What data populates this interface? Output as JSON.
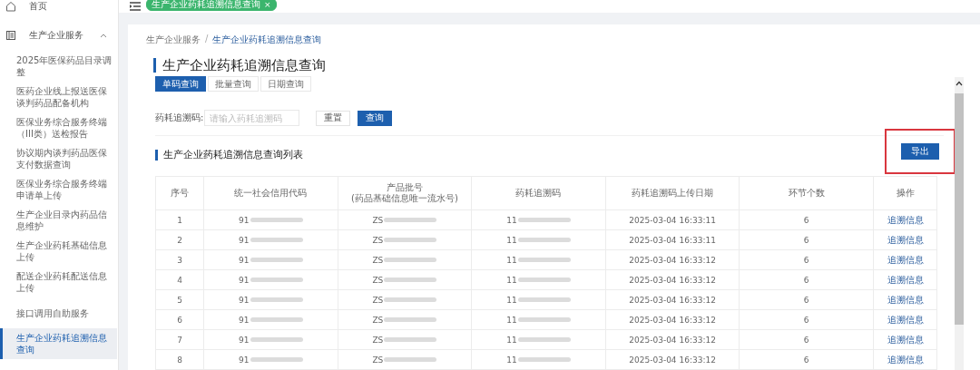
{
  "sidebar": {
    "items": [
      {
        "label": "首页",
        "kind": "home"
      },
      {
        "label": "生产企业服务",
        "kind": "group",
        "expanded": true,
        "children": [
          {
            "label": "2025年医保药品目录调整",
            "selected": false
          },
          {
            "label": "医药企业线上报送医保谈判药品配备机构",
            "selected": false
          },
          {
            "label": "医保业务综合服务终端（III类）送检报告",
            "selected": false
          },
          {
            "label": "协议期内谈判药品医保支付数据查询",
            "selected": false
          },
          {
            "label": "医保业务综合服务终端申请单上传",
            "selected": false
          },
          {
            "label": "生产企业目录内药品信息维护",
            "selected": false
          },
          {
            "label": "生产企业药耗基础信息上传",
            "selected": false
          },
          {
            "label": "配送企业药耗配送信息上传",
            "selected": false
          },
          {
            "label": "接口调用自助服务",
            "selected": false
          },
          {
            "label": "生产企业药耗追溯信息查询",
            "selected": true
          }
        ]
      }
    ]
  },
  "open_tabs": [
    {
      "label": "生产企业药耗追溯信息查询",
      "close": "×",
      "selected": true
    }
  ],
  "breadcrumb": [
    "生产企业服务",
    "生产企业药耗追溯信息查询"
  ],
  "breadcrumb_separator": "/",
  "page_title": "生产企业药耗追溯信息查询",
  "query_tabs": [
    {
      "label": "单码查询",
      "selected": true
    },
    {
      "label": "批量查询",
      "selected": false
    },
    {
      "label": "日期查询",
      "selected": false
    }
  ],
  "filter": {
    "label": "药耗追溯码:",
    "placeholder": "请输入药耗追溯码",
    "buttons": [
      {
        "label": "重置",
        "kind": "plain"
      },
      {
        "label": "查询",
        "kind": "primary"
      }
    ]
  },
  "list_title": "生产企业药耗追溯信息查询列表",
  "export_button": {
    "label": "导出",
    "highlighted": true
  },
  "table": {
    "columns": [
      "序号",
      "统一社会信用代码",
      "产品批号\n(药品基础信息唯一流水号)",
      "药耗追溯码",
      "药耗追溯码上传日期",
      "环节个数",
      "操作"
    ],
    "rows": [
      {
        "cells": [
          "1",
          "91",
          "ZS",
          "11",
          "2025-03-04 16:33:11",
          "6"
        ],
        "action": "追溯信息"
      },
      {
        "cells": [
          "2",
          "91",
          "ZS",
          "11",
          "2025-03-04 16:33:11",
          "6"
        ],
        "action": "追溯信息"
      },
      {
        "cells": [
          "3",
          "91",
          "ZS",
          "11",
          "2025-03-04 16:33:12",
          "6"
        ],
        "action": "追溯信息"
      },
      {
        "cells": [
          "4",
          "91",
          "ZS",
          "11",
          "2025-03-04 16:33:12",
          "6"
        ],
        "action": "追溯信息"
      },
      {
        "cells": [
          "5",
          "91",
          "ZS",
          "11",
          "2025-03-04 16:33:12",
          "6"
        ],
        "action": "追溯信息"
      },
      {
        "cells": [
          "6",
          "91",
          "ZS",
          "11",
          "2025-03-04 16:33:12",
          "6"
        ],
        "action": "追溯信息"
      },
      {
        "cells": [
          "7",
          "91",
          "ZS",
          "11",
          "2025-03-04 16:33:12",
          "6"
        ],
        "action": "追溯信息"
      },
      {
        "cells": [
          "8",
          "91",
          "ZS",
          "11",
          "2025-03-04 16:33:12",
          "6"
        ],
        "action": "追溯信息"
      }
    ]
  }
}
